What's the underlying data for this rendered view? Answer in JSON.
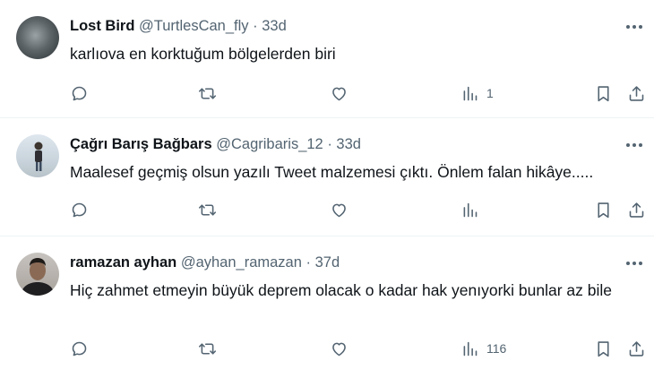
{
  "tweets": [
    {
      "name": "Lost Bird",
      "handle": "@TurtlesCan_fly",
      "separator": "·",
      "time": "33d",
      "text": "karlıova en korktuğum bölgelerden biri",
      "views": "1"
    },
    {
      "name": "Çağrı Barış Bağbars",
      "handle": "@Cagribaris_12",
      "separator": "·",
      "time": "33d",
      "text": "Maalesef geçmiş olsun yazılı Tweet malzemesi çıktı. Önlem falan hikâye.....",
      "views": ""
    },
    {
      "name": "ramazan ayhan",
      "handle": "@ayhan_ramazan",
      "separator": "·",
      "time": "37d",
      "text": "Hiç zahmet etmeyin büyük deprem olacak o kadar hak yenıyorki bunlar az bile",
      "views": "116"
    }
  ],
  "icons": {
    "reply": "reply-icon",
    "retweet": "retweet-icon",
    "like": "heart-icon",
    "views": "analytics-icon",
    "bookmark": "bookmark-icon",
    "share": "share-icon",
    "more": "more-icon"
  },
  "colors": {
    "text": "#0f1419",
    "secondary": "#536471",
    "divider": "#eff3f4"
  }
}
